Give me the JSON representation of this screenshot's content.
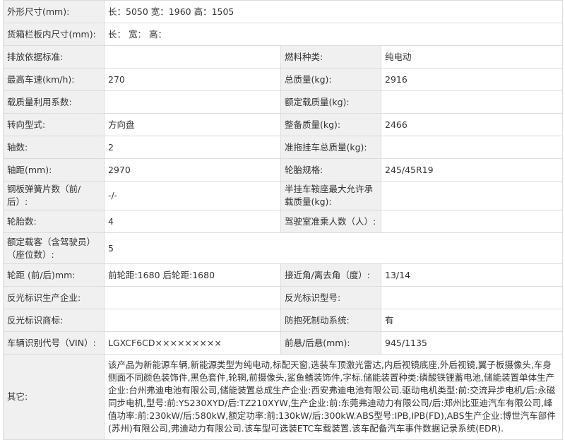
{
  "rows": {
    "dims": {
      "label": "外形尺寸(mm):",
      "value": "长：5050 宽：1960 高：1505"
    },
    "cargo": {
      "label": "货箱栏板内尺寸(mm):",
      "value": "长：  宽：  高："
    },
    "emission": {
      "label": "排放依据标准:",
      "value": ""
    },
    "fuel": {
      "label": "燃料种类:",
      "value": "纯电动"
    },
    "max_speed": {
      "label": "最高车速(km/h):",
      "value": "270"
    },
    "total_mass": {
      "label": "总质量(kg):",
      "value": "2916"
    },
    "load_util": {
      "label": "载质量利用系数:",
      "value": ""
    },
    "rated_load": {
      "label": "额定载质量(kg):",
      "value": ""
    },
    "steering": {
      "label": "转向型式:",
      "value": "方向盘"
    },
    "curb_mass": {
      "label": "整备质量(kg):",
      "value": "2466"
    },
    "axles": {
      "label": "轴数:",
      "value": "2"
    },
    "trailer_mass": {
      "label": "准拖挂车总质量(kg):",
      "value": ""
    },
    "wheelbase": {
      "label": "轴距(mm):",
      "value": "2970"
    },
    "tire": {
      "label": "轮胎规格:",
      "value": "245/45R19"
    },
    "leaf_spring": {
      "label": "钢板弹簧片数（前/后）:",
      "value": "-/-"
    },
    "saddle": {
      "label": "半挂车鞍座最大允许承载质量(kg):",
      "value": ""
    },
    "tires_count": {
      "label": "轮胎数:",
      "value": "4"
    },
    "cab_passengers": {
      "label": "驾驶室准乘人数（人）:",
      "value": ""
    },
    "seats": {
      "label": "额定载客（含驾驶员）（座位数）:",
      "value": "5"
    },
    "track": {
      "label": "轮距 (前/后)mm:",
      "value": "前轮距:1680 后轮距:1680"
    },
    "angles": {
      "label": "接近角/离去角（度）:",
      "value": "13/14"
    },
    "reflector_maker": {
      "label": "反光标识生产企业:",
      "value": ""
    },
    "reflector_model": {
      "label": "反光标识型号:",
      "value": ""
    },
    "reflector_brand": {
      "label": "反光标识商标:",
      "value": ""
    },
    "abs": {
      "label": "防抱死制动系统:",
      "value": "有"
    },
    "vin": {
      "label": "车辆识别代号（VIN）:",
      "value": "LGXCF6CD×××××××××"
    },
    "overhang": {
      "label": "前悬/后悬(mm):",
      "value": "945/1135"
    },
    "other": {
      "label": "其它:",
      "value": "该产品为新能源车辆,新能源类型为纯电动,标配天窗,选装车顶激光雷达,内后视镜底座,外后视镜,翼子板摄像头,车身侧面不同颜色装饰件,黑色套件,轮辋,前摄像头,鲨鱼鳍装饰件,字标.储能装置种类:磷酸铁锂蓄电池,储能装置单体生产企业:台州弗迪电池有限公司,储能装置总成生产企业:西安弗迪电池有限公司.驱动电机类型:前:交流异步电机/后:永磁同步电机,型号:前:YS230XYD/后:TZ210XYW,生产企业:前:东莞弗迪动力有限公司/后:郑州比亚迪汽车有限公司,峰值功率:前:230kW/后:580kW,额定功率:前:130kW/后:300kW.ABS型号:IPB,IPB(FD),ABS生产企业:博世汽车部件(苏州)有限公司,弗迪动力有限公司.该车型可选装ETC车载装置.该车配备汽车事件数据记录系统(EDR)."
    }
  }
}
